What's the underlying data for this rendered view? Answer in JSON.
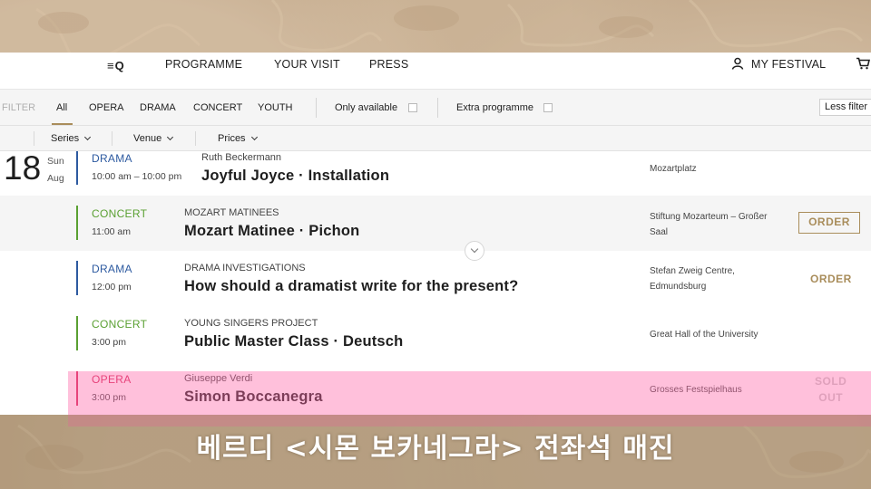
{
  "nav": {
    "menu_icon": "≡Q",
    "programme": "PROGRAMME",
    "your_visit": "YOUR VISIT",
    "press": "PRESS",
    "my_festival": "MY FESTIVAL",
    "user_icon": "user-icon",
    "cart_icon": "cart-icon"
  },
  "filters": {
    "label": "FILTER",
    "tabs": [
      "All",
      "OPERA",
      "DRAMA",
      "CONCERT",
      "YOUTH"
    ],
    "active_tab": "All",
    "only_available": "Only available",
    "extra_programme": "Extra programme",
    "less_filter": "Less filter"
  },
  "subfilters": [
    "Series",
    "Venue",
    "Prices"
  ],
  "date": {
    "day": "18",
    "weekday": "Sun",
    "month": "Aug"
  },
  "events": [
    {
      "category": "DRAMA",
      "category_color": "#2d5aa0",
      "time": "10:00 am – 10:00 pm",
      "series": "Ruth Beckermann",
      "title": "Joyful Joyce · Installation",
      "venue": "Mozartplatz",
      "action": ""
    },
    {
      "category": "CONCERT",
      "category_color": "#5aa032",
      "time": "11:00 am",
      "series": "MOZART MATINEES",
      "title": "Mozart Matinee · Pichon",
      "venue": "Stiftung Mozarteum – Großer Saal",
      "action": "ORDER"
    },
    {
      "category": "DRAMA",
      "category_color": "#2d5aa0",
      "time": "12:00 pm",
      "series": "DRAMA INVESTIGATIONS",
      "title": "How should a dramatist write for the present?",
      "venue": "Stefan Zweig Centre, Edmundsburg",
      "action": "ORDER"
    },
    {
      "category": "CONCERT",
      "category_color": "#5aa032",
      "time": "3:00 pm",
      "series": "YOUNG SINGERS PROJECT",
      "title": "Public Master Class · Deutsch",
      "venue": "Great Hall of the University",
      "action": ""
    },
    {
      "category": "OPERA",
      "category_color": "#d6285a",
      "time": "3:00 pm",
      "series": "Giuseppe Verdi",
      "title": "Simon Boccanegra",
      "venue": "Grosses Festspielhaus",
      "action_line1": "SOLD",
      "action_line2": "OUT"
    }
  ],
  "caption": "베르디 <시몬 보카네그라> 전좌석 매진",
  "colors": {
    "accent": "#a98d5b",
    "highlight": "#ff69aa",
    "background": "#c2a88a"
  }
}
